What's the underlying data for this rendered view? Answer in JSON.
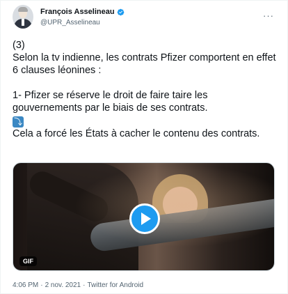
{
  "author": {
    "display_name": "François Asselineau",
    "handle": "@UPR_Asselineau",
    "verified": true,
    "avatar_icon": "avatar-photo"
  },
  "more_icon": "more-options-icon",
  "tweet": {
    "lines": [
      "(3)",
      "Selon la tv indienne, les contrats Pfizer comportent en effet 6 clauses léonines :",
      "1- Pfizer se réserve le droit de faire taire les gouvernements par le biais de ses contrats.",
      "Cela a forcé les États à cacher le contenu des contrats."
    ],
    "emoji": "⤵"
  },
  "media": {
    "badge": "GIF",
    "play_icon": "play-icon"
  },
  "meta": {
    "time": "4:06 PM",
    "separator": "·",
    "date": "2 nov. 2021",
    "source": "Twitter for Android"
  },
  "colors": {
    "accent": "#1d9bf0",
    "text": "#0f1419",
    "secondary": "#536471"
  }
}
